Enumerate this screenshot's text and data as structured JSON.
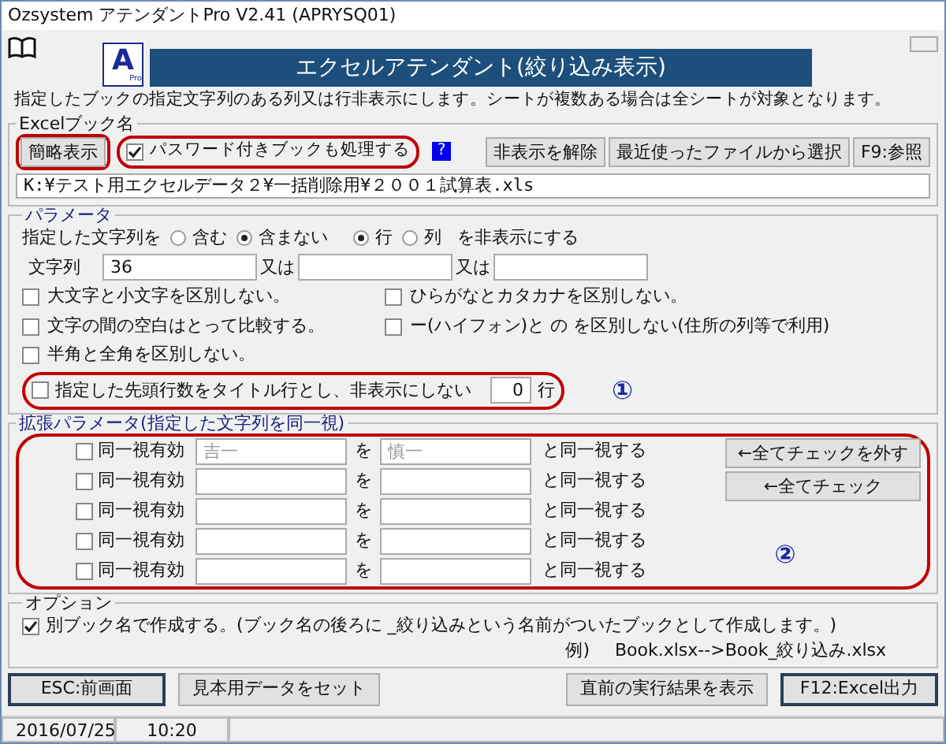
{
  "window": {
    "title": "Ozsystem アテンダントPro V2.41 (APRYSQ01)"
  },
  "header": {
    "logo": "A",
    "logo_sub": "Pro",
    "title": "エクセルアテンダント(絞り込み表示)"
  },
  "description": "指定したブックの指定文字列のある列又は行非表示にします。シートが複数ある場合は全シートが対象となります。",
  "book_group": {
    "label": "Excelブック名",
    "simple_button": "簡略表示",
    "password_checkbox": {
      "label": "パスワード付きブックも処理する",
      "checked": true
    },
    "help": "?",
    "buttons": [
      "非表示を解除",
      "最近使ったファイルから選択",
      "F9:参照"
    ],
    "path": "K:¥テスト用エクセルデータ２¥一括削除用¥２００１試算表.xls"
  },
  "parameters": {
    "label": "パラメータ",
    "mode_label": "指定した文字列を",
    "contain_options": [
      {
        "label": "含む",
        "selected": false
      },
      {
        "label": "含まない",
        "selected": true
      }
    ],
    "target_options": [
      {
        "label": "行",
        "selected": true
      },
      {
        "label": "列",
        "selected": false
      }
    ],
    "mode_suffix": "を非表示にする",
    "fields": [
      {
        "label": "文字列",
        "value": "36"
      },
      {
        "label": "又は"
      },
      {
        "label": "又は"
      }
    ],
    "options": [
      {
        "label": "大文字と小文字を区別しない。",
        "checked": false
      },
      {
        "label": "ひらがなとカタカナを区別しない。",
        "checked": false
      },
      {
        "label": "文字の間の空白はとって比較する。",
        "checked": false
      },
      {
        "label": "ー(ハイフォン)と の を区別しない(住所の列等で利用)",
        "checked": false
      },
      {
        "label": "半角と全角を区別しない。",
        "checked": false
      }
    ],
    "title_row": {
      "label": "指定した先頭行数をタイトル行とし、非表示にしない",
      "checked": false,
      "value": "0",
      "unit": "行"
    },
    "marker": "①"
  },
  "equivalence": {
    "label": "拡張パラメータ(指定した文字列を同一視)",
    "rows": [
      {
        "label": "同一視有効",
        "checked": false,
        "from_placeholder": "吉一",
        "particle": "を",
        "to_placeholder": "慎一",
        "suffix": "と同一視する"
      },
      {
        "label": "同一視有効",
        "checked": false,
        "particle": "を",
        "suffix": "と同一視する"
      },
      {
        "label": "同一視有効",
        "checked": false,
        "particle": "を",
        "suffix": "と同一視する"
      },
      {
        "label": "同一視有効",
        "checked": false,
        "particle": "を",
        "suffix": "と同一視する"
      },
      {
        "label": "同一視有効",
        "checked": false,
        "particle": "を",
        "suffix": "と同一視する"
      }
    ],
    "buttons": [
      "←全てチェックを外す",
      "←全てチェック"
    ],
    "marker": "②"
  },
  "output_options": {
    "label": "オプション",
    "checkbox": {
      "label": "別ブック名で作成する。(ブック名の後ろに _絞り込みという名前がついたブックとして作成します。)",
      "checked": true
    },
    "example_label": "例)",
    "example": "Book.xlsx-->Book_絞り込み.xlsx"
  },
  "footer_buttons": [
    {
      "label": "ESC:前画面",
      "primary": true
    },
    {
      "label": "見本用データをセット",
      "primary": false
    },
    {
      "label": "直前の実行結果を表示",
      "primary": false
    },
    {
      "label": "F12:Excel出力",
      "primary": true
    }
  ],
  "status_bar": [
    "2016/07/25",
    "10:20"
  ]
}
